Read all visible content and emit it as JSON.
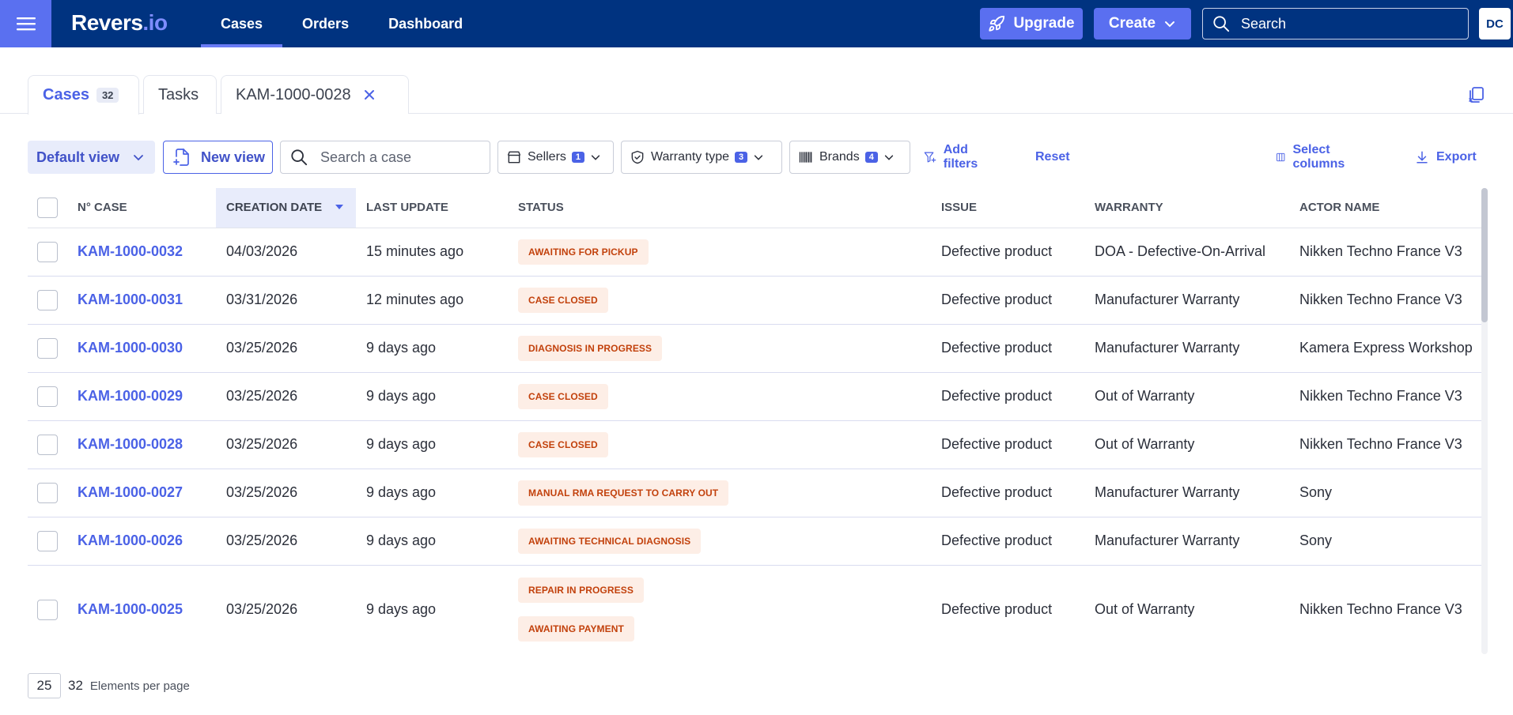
{
  "header": {
    "logo_main": "Revers",
    "logo_dot": ".io",
    "nav": [
      {
        "label": "Cases",
        "active": true
      },
      {
        "label": "Orders",
        "active": false
      },
      {
        "label": "Dashboard",
        "active": false
      }
    ],
    "upgrade_label": "Upgrade",
    "create_label": "Create",
    "search_placeholder": "Search",
    "avatar_initials": "DC"
  },
  "tabs": [
    {
      "label": "Cases",
      "count": "32",
      "active": true
    },
    {
      "label": "Tasks"
    },
    {
      "label": "KAM-1000-0028",
      "closable": true
    }
  ],
  "filters": {
    "view_label": "Default view",
    "new_view_label": "New view",
    "search_placeholder": "Search a case",
    "chips": [
      {
        "label": "Sellers",
        "count": "1",
        "icon": "store-icon"
      },
      {
        "label": "Warranty type",
        "count": "3",
        "icon": "shield-icon"
      },
      {
        "label": "Brands",
        "count": "4",
        "icon": "barcode-icon"
      }
    ],
    "add_filters_label": "Add filters",
    "reset_label": "Reset",
    "select_columns_label": "Select columns",
    "export_label": "Export"
  },
  "table": {
    "columns": [
      "N° CASE",
      "CREATION DATE",
      "LAST UPDATE",
      "STATUS",
      "ISSUE",
      "WARRANTY",
      "ACTOR NAME"
    ],
    "sorted_column": "CREATION DATE",
    "rows": [
      {
        "case": "KAM-1000-0032",
        "date": "04/03/2026",
        "update": "15 minutes ago",
        "status": [
          "AWAITING FOR PICKUP"
        ],
        "issue": "Defective product",
        "warranty": "DOA - Defective-On-Arrival",
        "actor": "Nikken Techno France V3"
      },
      {
        "case": "KAM-1000-0031",
        "date": "03/31/2026",
        "update": "12 minutes ago",
        "status": [
          "CASE CLOSED"
        ],
        "issue": "Defective product",
        "warranty": "Manufacturer Warranty",
        "actor": "Nikken Techno France V3"
      },
      {
        "case": "KAM-1000-0030",
        "date": "03/25/2026",
        "update": "9 days ago",
        "status": [
          "DIAGNOSIS IN PROGRESS"
        ],
        "issue": "Defective product",
        "warranty": "Manufacturer Warranty",
        "actor": "Kamera Express Workshop"
      },
      {
        "case": "KAM-1000-0029",
        "date": "03/25/2026",
        "update": "9 days ago",
        "status": [
          "CASE CLOSED"
        ],
        "issue": "Defective product",
        "warranty": "Out of Warranty",
        "actor": "Nikken Techno France V3"
      },
      {
        "case": "KAM-1000-0028",
        "date": "03/25/2026",
        "update": "9 days ago",
        "status": [
          "CASE CLOSED"
        ],
        "issue": "Defective product",
        "warranty": "Out of Warranty",
        "actor": "Nikken Techno France V3"
      },
      {
        "case": "KAM-1000-0027",
        "date": "03/25/2026",
        "update": "9 days ago",
        "status": [
          "MANUAL RMA REQUEST TO CARRY OUT"
        ],
        "issue": "Defective product",
        "warranty": "Manufacturer Warranty",
        "actor": "Sony"
      },
      {
        "case": "KAM-1000-0026",
        "date": "03/25/2026",
        "update": "9 days ago",
        "status": [
          "AWAITING TECHNICAL DIAGNOSIS"
        ],
        "issue": "Defective product",
        "warranty": "Manufacturer Warranty",
        "actor": "Sony"
      },
      {
        "case": "KAM-1000-0025",
        "date": "03/25/2026",
        "update": "9 days ago",
        "status": [
          "REPAIR IN PROGRESS",
          "AWAITING PAYMENT"
        ],
        "issue": "Defective product",
        "warranty": "Out of Warranty",
        "actor": "Nikken Techno France V3"
      }
    ]
  },
  "pagination": {
    "per_page": "25",
    "total": "32",
    "label": "Elements per page"
  },
  "colors": {
    "topbar": "#003380",
    "accent": "#4b62e6",
    "status_bg": "#fdeee6",
    "status_text": "#c2410c"
  }
}
